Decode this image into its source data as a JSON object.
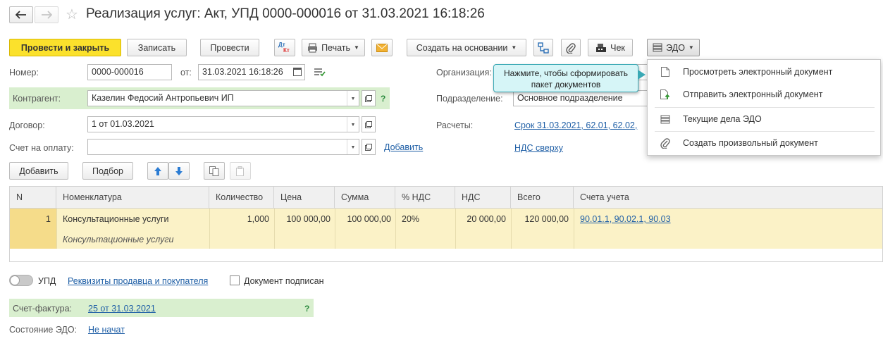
{
  "title": "Реализация услуг: Акт, УПД 0000-000016 от 31.03.2021 16:18:26",
  "toolbar": {
    "post_close": "Провести и закрыть",
    "save": "Записать",
    "post": "Провести",
    "dtkt_top": "Дт",
    "dtkt_bottom": "Кт",
    "print": "Печать",
    "create_based_on": "Создать на основании",
    "check": "Чек",
    "edo": "ЭДО"
  },
  "header": {
    "number_label": "Номер:",
    "number_value": "0000-000016",
    "date_label": "от:",
    "date_value": "31.03.2021 16:18:26",
    "counterparty_label": "Контрагент:",
    "counterparty_value": "Казелин Федосий Антропьевич ИП",
    "contract_label": "Договор:",
    "contract_value": "1 от 01.03.2021",
    "invoice_label": "Счет на оплату:",
    "invoice_value": "",
    "add_link": "Добавить",
    "organization_label": "Организация:",
    "subdivision_label": "Подразделение:",
    "subdivision_value": "Основное подразделение",
    "settlements_label": "Расчеты:",
    "settlements_link": "Срок 31.03.2021, 62.01, 62.02,",
    "vat_link": "НДС сверху",
    "help": "?"
  },
  "table_toolbar": {
    "add": "Добавить",
    "selection": "Подбор"
  },
  "table": {
    "columns": [
      "N",
      "Номенклатура",
      "Количество",
      "Цена",
      "Сумма",
      "% НДС",
      "НДС",
      "Всего",
      "Счета учета"
    ],
    "rows": [
      {
        "n": "1",
        "item": "Консультационные услуги",
        "item_desc": "Консультационные услуги",
        "qty": "1,000",
        "price": "100 000,00",
        "sum": "100 000,00",
        "vat_rate": "20%",
        "vat": "20 000,00",
        "total": "120 000,00",
        "accounts": "90.01.1, 90.02.1, 90.03"
      }
    ]
  },
  "footer": {
    "upd_label": "УПД",
    "requisites_link": "Реквизиты продавца и покупателя",
    "signed_label": "Документ подписан",
    "invoice_label": "Счет-фактура:",
    "invoice_link": "25 от 31.03.2021",
    "edo_state_label": "Состояние ЭДО:",
    "edo_state_link": "Не начат"
  },
  "edo_menu": {
    "items": [
      {
        "label": "Просмотреть электронный документ",
        "icon": "document-icon"
      },
      {
        "label": "Отправить электронный документ",
        "icon": "send-document-icon"
      },
      {
        "label": "Текущие дела ЭДО",
        "icon": "edo-tasks-icon"
      },
      {
        "label": "Создать произвольный документ",
        "icon": "paperclip-icon"
      }
    ]
  },
  "tooltip": {
    "line1": "Нажмите, чтобы сформировать",
    "line2": "пакет документов"
  },
  "colors": {
    "primary_button": "#fbe12c",
    "highlight_green": "#d9efcf",
    "selected_row": "#fbf2c7",
    "link": "#1f5fa6",
    "tooltip_bg": "#d6f5f7"
  }
}
